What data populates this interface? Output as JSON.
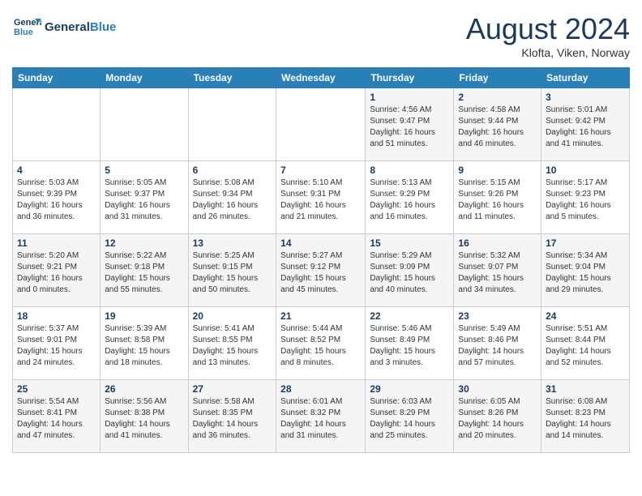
{
  "header": {
    "logo_line1": "General",
    "logo_line2": "Blue",
    "month": "August 2024",
    "location": "Klofta, Viken, Norway"
  },
  "days_of_week": [
    "Sunday",
    "Monday",
    "Tuesday",
    "Wednesday",
    "Thursday",
    "Friday",
    "Saturday"
  ],
  "weeks": [
    [
      {
        "day": "",
        "info": ""
      },
      {
        "day": "",
        "info": ""
      },
      {
        "day": "",
        "info": ""
      },
      {
        "day": "",
        "info": ""
      },
      {
        "day": "1",
        "info": "Sunrise: 4:56 AM\nSunset: 9:47 PM\nDaylight: 16 hours\nand 51 minutes."
      },
      {
        "day": "2",
        "info": "Sunrise: 4:58 AM\nSunset: 9:44 PM\nDaylight: 16 hours\nand 46 minutes."
      },
      {
        "day": "3",
        "info": "Sunrise: 5:01 AM\nSunset: 9:42 PM\nDaylight: 16 hours\nand 41 minutes."
      }
    ],
    [
      {
        "day": "4",
        "info": "Sunrise: 5:03 AM\nSunset: 9:39 PM\nDaylight: 16 hours\nand 36 minutes."
      },
      {
        "day": "5",
        "info": "Sunrise: 5:05 AM\nSunset: 9:37 PM\nDaylight: 16 hours\nand 31 minutes."
      },
      {
        "day": "6",
        "info": "Sunrise: 5:08 AM\nSunset: 9:34 PM\nDaylight: 16 hours\nand 26 minutes."
      },
      {
        "day": "7",
        "info": "Sunrise: 5:10 AM\nSunset: 9:31 PM\nDaylight: 16 hours\nand 21 minutes."
      },
      {
        "day": "8",
        "info": "Sunrise: 5:13 AM\nSunset: 9:29 PM\nDaylight: 16 hours\nand 16 minutes."
      },
      {
        "day": "9",
        "info": "Sunrise: 5:15 AM\nSunset: 9:26 PM\nDaylight: 16 hours\nand 11 minutes."
      },
      {
        "day": "10",
        "info": "Sunrise: 5:17 AM\nSunset: 9:23 PM\nDaylight: 16 hours\nand 5 minutes."
      }
    ],
    [
      {
        "day": "11",
        "info": "Sunrise: 5:20 AM\nSunset: 9:21 PM\nDaylight: 16 hours\nand 0 minutes."
      },
      {
        "day": "12",
        "info": "Sunrise: 5:22 AM\nSunset: 9:18 PM\nDaylight: 15 hours\nand 55 minutes."
      },
      {
        "day": "13",
        "info": "Sunrise: 5:25 AM\nSunset: 9:15 PM\nDaylight: 15 hours\nand 50 minutes."
      },
      {
        "day": "14",
        "info": "Sunrise: 5:27 AM\nSunset: 9:12 PM\nDaylight: 15 hours\nand 45 minutes."
      },
      {
        "day": "15",
        "info": "Sunrise: 5:29 AM\nSunset: 9:09 PM\nDaylight: 15 hours\nand 40 minutes."
      },
      {
        "day": "16",
        "info": "Sunrise: 5:32 AM\nSunset: 9:07 PM\nDaylight: 15 hours\nand 34 minutes."
      },
      {
        "day": "17",
        "info": "Sunrise: 5:34 AM\nSunset: 9:04 PM\nDaylight: 15 hours\nand 29 minutes."
      }
    ],
    [
      {
        "day": "18",
        "info": "Sunrise: 5:37 AM\nSunset: 9:01 PM\nDaylight: 15 hours\nand 24 minutes."
      },
      {
        "day": "19",
        "info": "Sunrise: 5:39 AM\nSunset: 8:58 PM\nDaylight: 15 hours\nand 18 minutes."
      },
      {
        "day": "20",
        "info": "Sunrise: 5:41 AM\nSunset: 8:55 PM\nDaylight: 15 hours\nand 13 minutes."
      },
      {
        "day": "21",
        "info": "Sunrise: 5:44 AM\nSunset: 8:52 PM\nDaylight: 15 hours\nand 8 minutes."
      },
      {
        "day": "22",
        "info": "Sunrise: 5:46 AM\nSunset: 8:49 PM\nDaylight: 15 hours\nand 3 minutes."
      },
      {
        "day": "23",
        "info": "Sunrise: 5:49 AM\nSunset: 8:46 PM\nDaylight: 14 hours\nand 57 minutes."
      },
      {
        "day": "24",
        "info": "Sunrise: 5:51 AM\nSunset: 8:44 PM\nDaylight: 14 hours\nand 52 minutes."
      }
    ],
    [
      {
        "day": "25",
        "info": "Sunrise: 5:54 AM\nSunset: 8:41 PM\nDaylight: 14 hours\nand 47 minutes."
      },
      {
        "day": "26",
        "info": "Sunrise: 5:56 AM\nSunset: 8:38 PM\nDaylight: 14 hours\nand 41 minutes."
      },
      {
        "day": "27",
        "info": "Sunrise: 5:58 AM\nSunset: 8:35 PM\nDaylight: 14 hours\nand 36 minutes."
      },
      {
        "day": "28",
        "info": "Sunrise: 6:01 AM\nSunset: 8:32 PM\nDaylight: 14 hours\nand 31 minutes."
      },
      {
        "day": "29",
        "info": "Sunrise: 6:03 AM\nSunset: 8:29 PM\nDaylight: 14 hours\nand 25 minutes."
      },
      {
        "day": "30",
        "info": "Sunrise: 6:05 AM\nSunset: 8:26 PM\nDaylight: 14 hours\nand 20 minutes."
      },
      {
        "day": "31",
        "info": "Sunrise: 6:08 AM\nSunset: 8:23 PM\nDaylight: 14 hours\nand 14 minutes."
      }
    ]
  ]
}
